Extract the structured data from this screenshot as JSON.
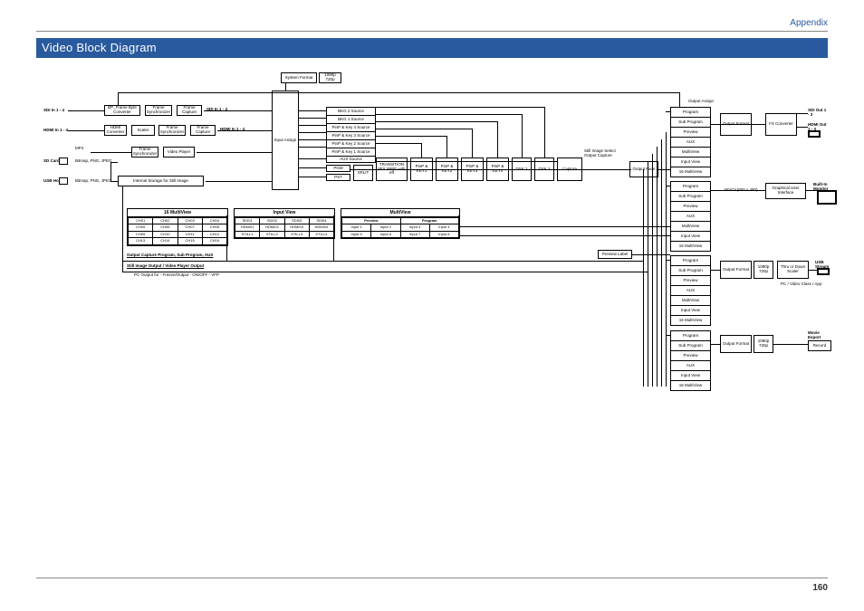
{
  "header": {
    "appendix": "Appendix",
    "title": "Video Block Diagram",
    "page_number": "160"
  },
  "inputs": {
    "sdi_in": "SDI In 1 - 4",
    "hdmi_in": "HDMI In 1 - 4",
    "sd_card": "SD Card",
    "usb_host": "USB Host",
    "file_types": "Bitmap, PNG, JPEG",
    "mp4": "MP4"
  },
  "input_stage": {
    "genlock": "BP_Frame Byte Converter",
    "scaler": "Scaler",
    "hdmi_conv": "HDMI Converter",
    "frame_sync": "Frame Synchronizer",
    "frame_capture": "Frame Capture",
    "video_player": "Video Player",
    "storage": "Internal Storage for Still Image",
    "sdi_mid": "SDI In 1 - 4",
    "hdmi_mid": "HDMI In 1 - 4"
  },
  "system": {
    "system_format": "System Format",
    "formats": "1080p\n720p",
    "input_assign": "Input Assign"
  },
  "sources": {
    "bkg2": "BKG 2 Source",
    "bkg1": "BKG 1 Source",
    "pinp4": "PinP & Key 4 Source",
    "pinp3": "PinP & Key 3 Source",
    "pinp2": "PinP & Key 2 Source",
    "pinp1": "PinP & Key 1 Source",
    "aux": "AUX Source",
    "pgm": "PGM",
    "pst": "PST"
  },
  "mixer": {
    "split": "SPLIT",
    "transition": "TRANSITION MIX WIPE with eff",
    "pinp1": "PinP & KEY1",
    "pinp2": "PinP & KEY2",
    "pinp3": "PinP & KEY3",
    "pinp4": "PinP & KEY4",
    "dsk1": "DSK 1",
    "dsk2": "DSK 2",
    "capture": "Capture",
    "oplabel": "Still Image Select Output Capture",
    "output_fade": "Output Fade"
  },
  "grids": {
    "multiview16": {
      "title": "16 MultiView",
      "cells": [
        "CH01",
        "CH02",
        "CH03",
        "CH04",
        "CH05",
        "CH06",
        "CH07",
        "CH08",
        "CH09",
        "CH10",
        "CH11",
        "CH12",
        "CH13",
        "CH14",
        "CH15",
        "CH16"
      ]
    },
    "inputview": {
      "title": "Input View",
      "cells": [
        "SDI01",
        "SDI02",
        "SDI03",
        "SDI04",
        "HDMI01",
        "HDMI02",
        "HDMI03",
        "HDMI04",
        "STILL1",
        "STILL2",
        "STILL3",
        "STILL4"
      ]
    },
    "multiview_pp": {
      "title": "MultiView",
      "preview": "Preview",
      "program": "Program",
      "cells": [
        "Input 1",
        "Input 2",
        "Input 3",
        "Input 4",
        "Input 5",
        "Input 6",
        "Input 7",
        "Input 8"
      ]
    },
    "footer1": "Output Capture Program, Sub Program, AUX",
    "footer2": "Still Image Output / Video Player Output",
    "footer3": "PC Output for - Freeze/Output - ON/OFF - VFP"
  },
  "outputs": {
    "output_assign": "Output Assign",
    "output_format": "Output Format",
    "formats": "1080p\n720p",
    "bus_items": [
      "Program",
      "Sub Program",
      "Preview",
      "AUX",
      "MultiView",
      "Input View",
      "16 MultiView"
    ],
    "preview_label": "Preview Label",
    "fs_converter": "FS Converter",
    "sdi_out": "SDI Out 1 - 3",
    "hdmi_out": "HDMI Out 1 - 3",
    "gui": "Graphical User Interface",
    "monitor_res": "WVGA(800 x 480)",
    "builtin": "Built-In Monitor",
    "thru_scaler": "Thru or Down Scaler",
    "usb_stream": "USB Stream",
    "pc_note": "PC / Video Class / App",
    "movie_export": "Movie Export",
    "record": "Record"
  }
}
